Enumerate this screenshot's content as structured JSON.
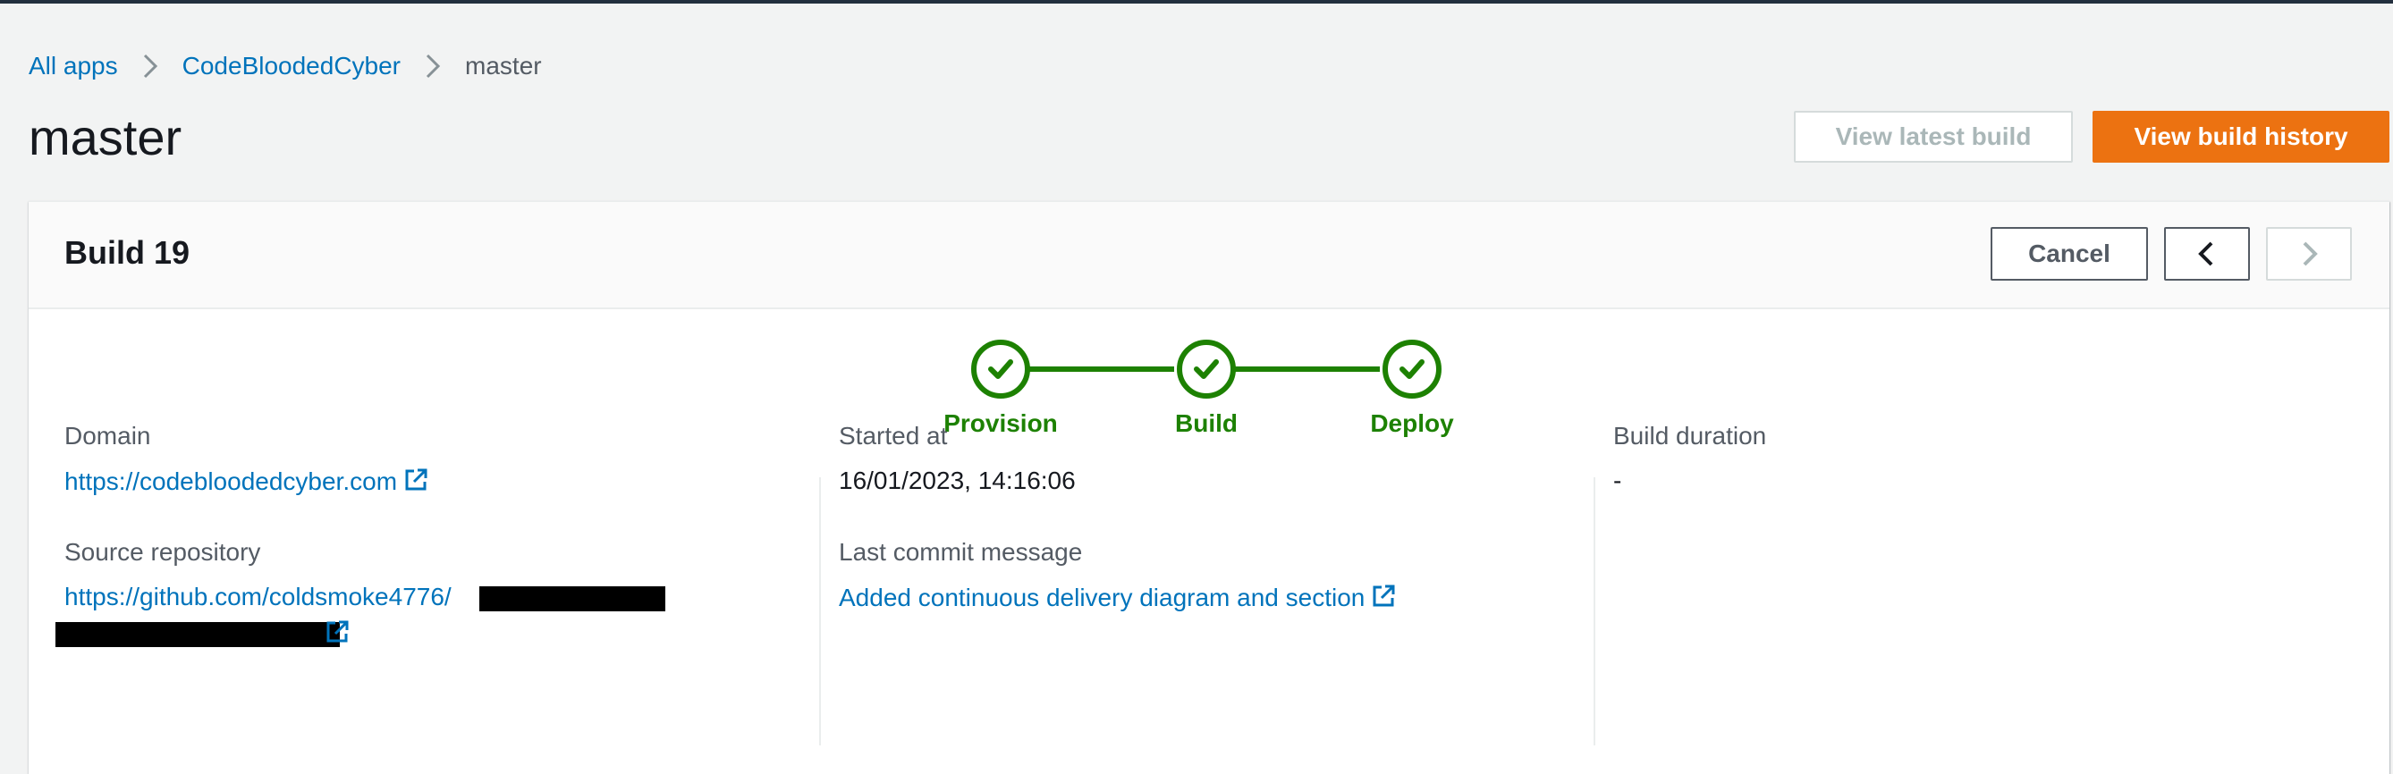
{
  "breadcrumb": {
    "items": [
      {
        "label": "All apps"
      },
      {
        "label": "CodeBloodedCyber"
      },
      {
        "label": "master"
      }
    ]
  },
  "page": {
    "title": "master",
    "view_latest_build": "View latest build",
    "view_build_history": "View build history"
  },
  "build": {
    "title": "Build 19",
    "cancel_label": "Cancel",
    "steps": [
      {
        "label": "Provision",
        "status": "success"
      },
      {
        "label": "Build",
        "status": "success"
      },
      {
        "label": "Deploy",
        "status": "success"
      }
    ],
    "domain_label": "Domain",
    "domain_value": "https://codebloodedcyber.com",
    "source_repo_label": "Source repository",
    "source_repo_value": "https://github.com/coldsmoke4776/",
    "started_at_label": "Started at",
    "started_at_value": "16/01/2023, 14:16:06",
    "last_commit_label": "Last commit message",
    "last_commit_value": "Added continuous delivery diagram and section",
    "build_duration_label": "Build duration",
    "build_duration_value": "-"
  },
  "colors": {
    "accent_orange": "#ec7211",
    "success_green": "#1d8102",
    "link_blue": "#0073bb",
    "page_bg": "#f2f3f3"
  },
  "icons": {
    "breadcrumb_separator": "chevron-right-icon",
    "step_status": "check-icon",
    "external_link": "external-link-icon",
    "previous": "chevron-left-icon",
    "next": "chevron-right-icon"
  }
}
